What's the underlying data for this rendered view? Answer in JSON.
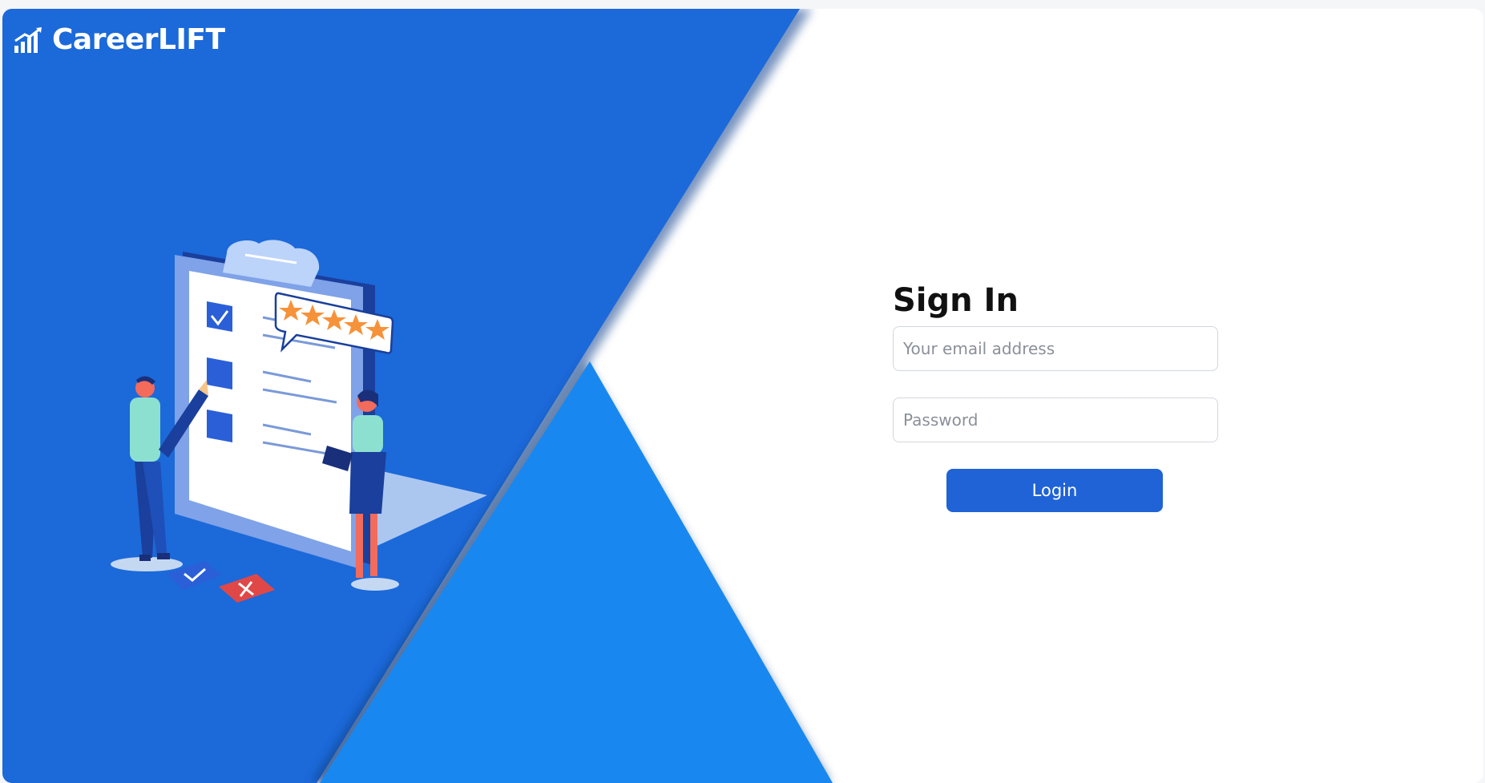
{
  "brand": {
    "name": "CareerLIFT",
    "icon": "bar-chart-up-icon"
  },
  "illustration": {
    "name": "checklist-rating-illustration",
    "stars": 5
  },
  "signin": {
    "title": "Sign In",
    "email_placeholder": "Your email address",
    "password_placeholder": "Password",
    "login_label": "Login"
  },
  "colors": {
    "primary_blue": "#1c69d9",
    "light_blue": "#1888f0",
    "button_blue": "#1f63d6",
    "white": "#ffffff"
  }
}
